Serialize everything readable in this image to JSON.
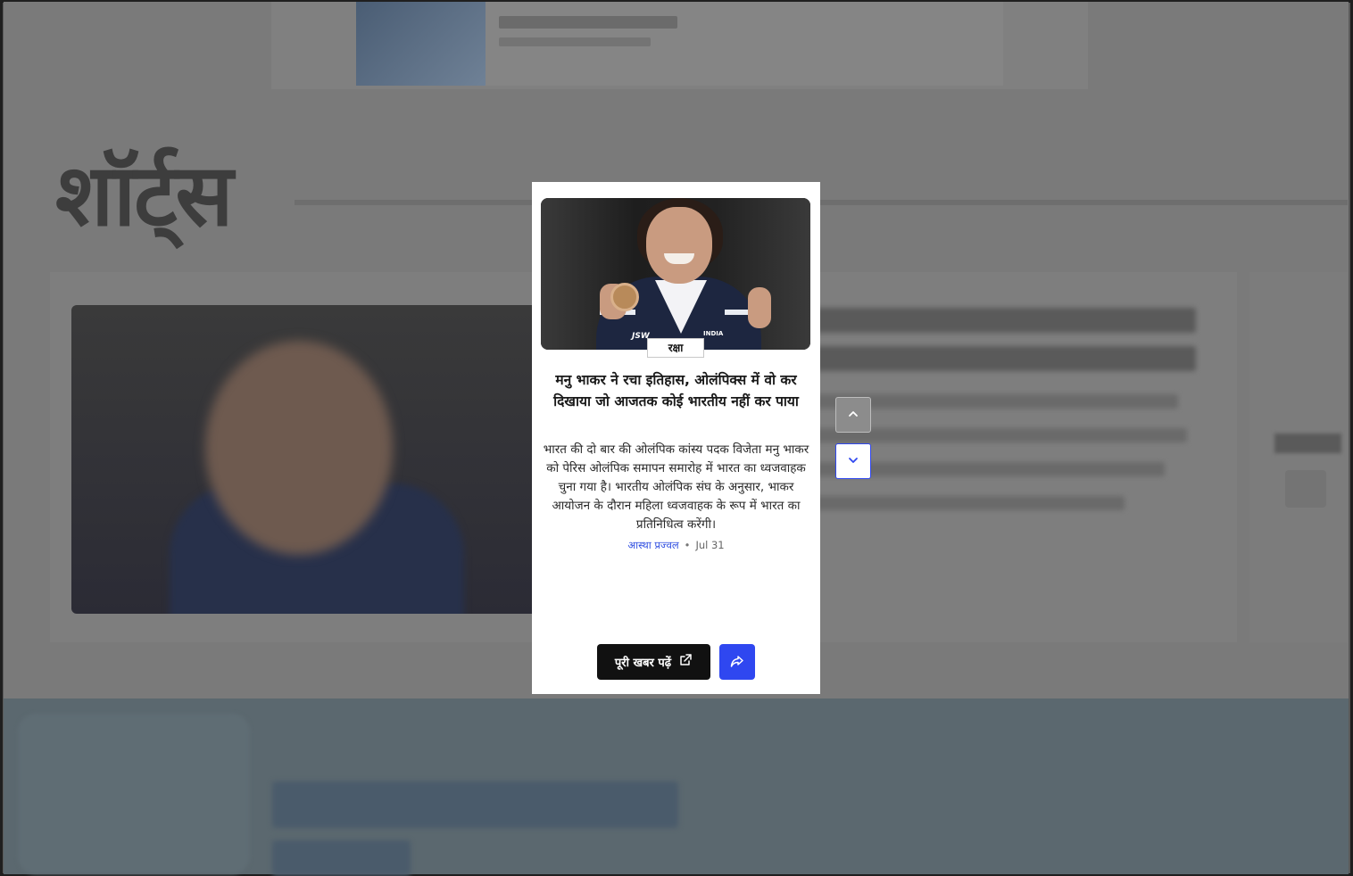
{
  "background": {
    "section_title": "शॉर्ट्स"
  },
  "modal": {
    "category": "रक्षा",
    "headline": "मनु भाकर ने रचा इतिहास, ओलंपिक्स में वो कर दिखाया जो आजतक कोई भारतीय नहीं कर पाया",
    "summary": "भारत की दो बार की ओलंपिक कांस्य पदक विजेता मनु भाकर को पेरिस ओलंपिक समापन समारोह में भारत का ध्वजवाहक चुना गया है। भारतीय ओलंपिक संघ के अनुसार, भाकर आयोजन के दौरान महिला ध्वजवाहक के रूप में भारत का प्रतिनिधित्व करेंगी।",
    "author": "आस्था प्रज्वल",
    "separator": "•",
    "date": "Jul 31",
    "read_full_label": "पूरी खबर पढ़ें",
    "image_text": {
      "sponsor": "JSW",
      "country": "INDIA"
    }
  },
  "navigation": {
    "up_icon": "chevron-up-icon",
    "down_icon": "chevron-down-icon"
  },
  "icons": {
    "external_link": "external-link-icon",
    "share": "share-icon"
  },
  "colors": {
    "accent": "#2f47f0",
    "author": "#2f4ee0",
    "overlay_bg": "#7a7a7a",
    "button_dark": "#111111"
  }
}
